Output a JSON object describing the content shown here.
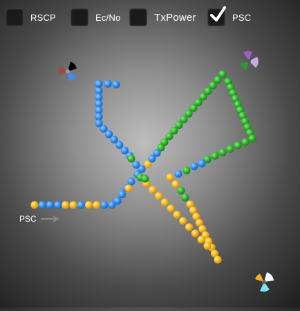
{
  "toolbar": {
    "items": [
      {
        "label": "RSCP",
        "checked": false
      },
      {
        "label": "Ec/No",
        "checked": false
      },
      {
        "label": "TxPower",
        "checked": false
      },
      {
        "label": "PSC",
        "checked": true
      }
    ]
  },
  "legend": {
    "label": "PSC",
    "icon": "arrow-right-icon"
  },
  "colors": {
    "blue": "#2f8cf0",
    "green": "#2db32a",
    "yellow": "#f7b51a",
    "background_center": "#bdbdbd",
    "background_edge": "#1e1e1e"
  },
  "sites": [
    {
      "name": "site-top-left",
      "sectors": [
        "#000000",
        "#3c8ef5",
        "#9c4a4a"
      ]
    },
    {
      "name": "site-top-right",
      "sectors": [
        "#9e5ec9",
        "#c8a8e8",
        "#2f9a2f"
      ]
    },
    {
      "name": "site-bottom-right",
      "sectors": [
        "#ffffff",
        "#7fe3ef",
        "#f5b21b"
      ]
    }
  ]
}
